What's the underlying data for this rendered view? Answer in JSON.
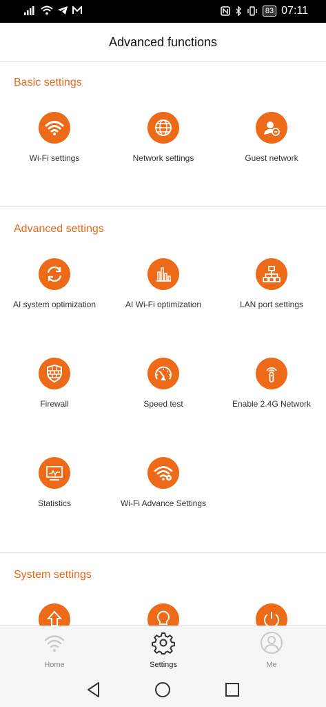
{
  "status_bar": {
    "battery": "83",
    "time": "07:11"
  },
  "header": {
    "title": "Advanced functions"
  },
  "sections": [
    {
      "title": "Basic settings",
      "items": [
        {
          "label": "Wi-Fi settings",
          "icon": "wifi-icon"
        },
        {
          "label": "Network settings",
          "icon": "globe-icon"
        },
        {
          "label": "Guest network",
          "icon": "guest-user-icon"
        }
      ]
    },
    {
      "title": "Advanced settings",
      "items": [
        {
          "label": "AI system optimization",
          "icon": "refresh-icon"
        },
        {
          "label": "AI Wi-Fi optimization",
          "icon": "bar-chart-icon"
        },
        {
          "label": "LAN port settings",
          "icon": "network-tree-icon"
        },
        {
          "label": "Firewall",
          "icon": "firewall-shield-icon"
        },
        {
          "label": "Speed test",
          "icon": "speedometer-icon"
        },
        {
          "label": "Enable 2.4G Network",
          "icon": "antenna-signal-icon"
        },
        {
          "label": "Statistics",
          "icon": "monitor-chart-icon"
        },
        {
          "label": "Wi-Fi Advance Settings",
          "icon": "wifi-gear-icon"
        }
      ]
    },
    {
      "title": "System settings",
      "items": [
        {
          "label": "",
          "icon": "upgrade-arrow-icon"
        },
        {
          "label": "",
          "icon": "lightbulb-icon"
        },
        {
          "label": "",
          "icon": "power-icon"
        }
      ]
    }
  ],
  "tabbar": {
    "tabs": [
      {
        "label": "Home",
        "icon": "wifi-icon"
      },
      {
        "label": "Settings",
        "icon": "gear-icon"
      },
      {
        "label": "Me",
        "icon": "user-icon"
      }
    ],
    "active": "Settings"
  },
  "colors": {
    "accent": "#ec6a18",
    "section_title": "#e8681a"
  }
}
